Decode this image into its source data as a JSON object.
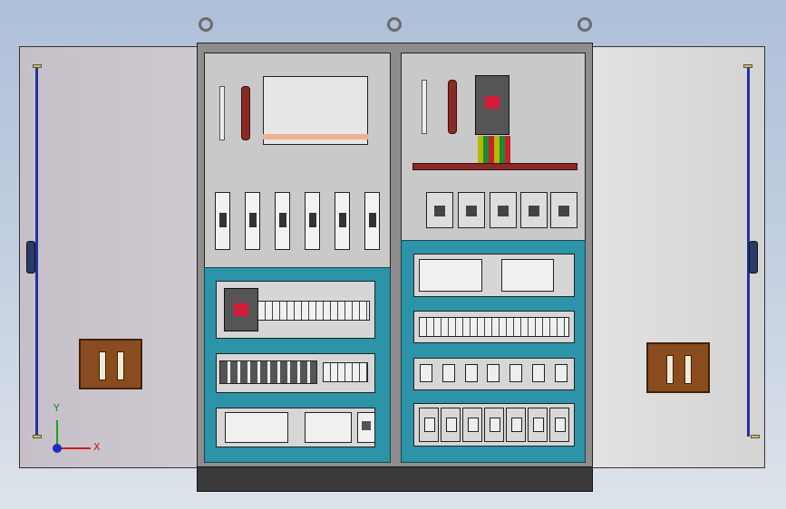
{
  "scene": {
    "description_labels": {
      "axis_x": "X",
      "axis_y": "Y"
    }
  },
  "colors": {
    "door_left": "#cbc5cf",
    "door_right": "#dcdcdc",
    "cabinet_frame": "#2c93a8",
    "busbar": "#8a2a24",
    "breaker_handle": "#d21a3a",
    "door_rod": "#2233a0",
    "nameplate": "#8a4c1e"
  },
  "icons": {
    "lifting_eye": "lifting-eye-icon",
    "axis_triad": "axis-triad-icon"
  }
}
